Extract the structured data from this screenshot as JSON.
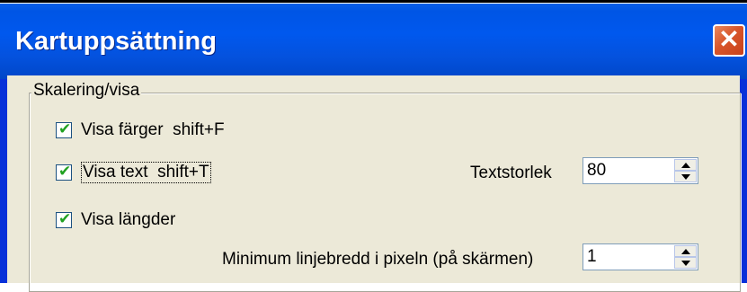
{
  "window": {
    "title": "Kartuppsättning",
    "close_label": "✕"
  },
  "group": {
    "legend": "Skalering/visa"
  },
  "checkboxes": [
    {
      "label": "Visa färger  shift+F",
      "checked": true
    },
    {
      "label": "Visa text  shift+T",
      "checked": true
    },
    {
      "label": "Visa längder",
      "checked": true
    }
  ],
  "checkmark_glyph": "✔",
  "textstorlek": {
    "label": "Textstorlek",
    "value": "80"
  },
  "min_linjebredd": {
    "label": "Minimum linjebredd i pixeln (på skärmen)",
    "value": "1"
  },
  "colors": {
    "titlebar": "#0058ee",
    "close_button": "#d8552a",
    "dialog_bg": "#ece9d8",
    "checkmark": "#21a121"
  }
}
